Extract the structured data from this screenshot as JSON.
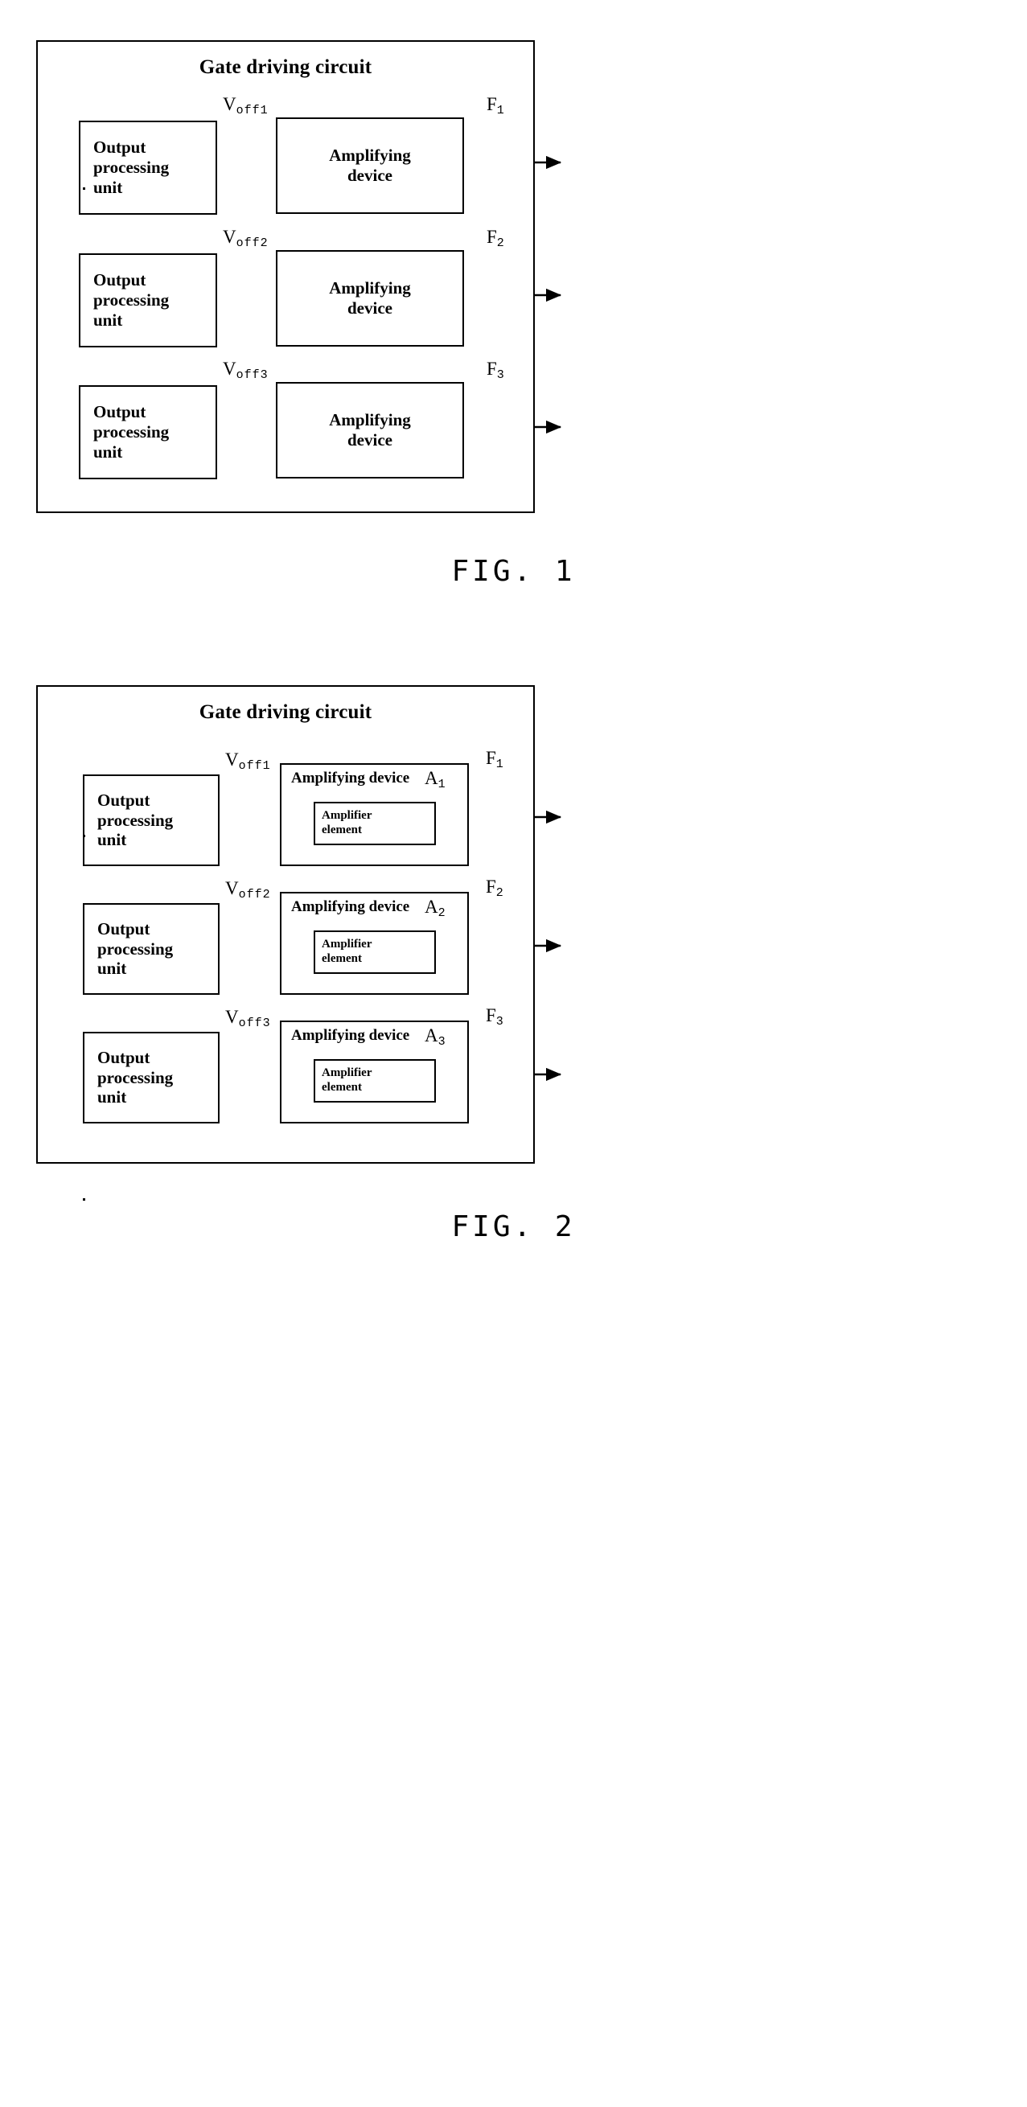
{
  "figures": [
    {
      "id": "fig1",
      "caption": "FIG.  1",
      "circuit_title": "Gate driving circuit",
      "rows": [
        {
          "source_label": "Output processing unit",
          "source_lines": [
            "Output",
            "processing",
            "unit"
          ],
          "voff_base": "V",
          "voff_sub": "off1",
          "amp_label": "Amplifying device",
          "amp_lines": [
            "Amplifying",
            "device"
          ],
          "out_base": "F",
          "out_sub": "1"
        },
        {
          "source_label": "Output processing unit",
          "source_lines": [
            "Output",
            "processing",
            "unit"
          ],
          "voff_base": "V",
          "voff_sub": "off2",
          "amp_label": "Amplifying device",
          "amp_lines": [
            "Amplifying",
            "device"
          ],
          "out_base": "F",
          "out_sub": "2"
        },
        {
          "source_label": "Output processing unit",
          "source_lines": [
            "Output",
            "processing",
            "unit"
          ],
          "voff_base": "V",
          "voff_sub": "off3",
          "amp_label": "Amplifying device",
          "amp_lines": [
            "Amplifying",
            "device"
          ],
          "out_base": "F",
          "out_sub": "3"
        }
      ]
    },
    {
      "id": "fig2",
      "caption": "FIG.  2",
      "circuit_title": "Gate driving circuit",
      "rows": [
        {
          "source_label": "Output processing unit",
          "source_lines": [
            "Output",
            "processing",
            "unit"
          ],
          "voff_base": "V",
          "voff_sub": "off1",
          "amp_label": "Amplifying device",
          "amp_ref_base": "A",
          "amp_ref_sub": "1",
          "element_label": "Amplifier element",
          "element_lines": [
            "Amplifier",
            "element"
          ],
          "out_base": "F",
          "out_sub": "1"
        },
        {
          "source_label": "Output processing unit",
          "source_lines": [
            "Output",
            "processing",
            "unit"
          ],
          "voff_base": "V",
          "voff_sub": "off2",
          "amp_label": "Amplifying device",
          "amp_ref_base": "A",
          "amp_ref_sub": "2",
          "element_label": "Amplifier element",
          "element_lines": [
            "Amplifier",
            "element"
          ],
          "out_base": "F",
          "out_sub": "2"
        },
        {
          "source_label": "Output processing unit",
          "source_lines": [
            "Output",
            "processing",
            "unit"
          ],
          "voff_base": "V",
          "voff_sub": "off3",
          "amp_label": "Amplifying device",
          "amp_ref_base": "A",
          "amp_ref_sub": "3",
          "element_label": "Amplifier element",
          "element_lines": [
            "Amplifier",
            "element"
          ],
          "out_base": "F",
          "out_sub": "3"
        }
      ]
    }
  ],
  "colors": {
    "ink": "#000000",
    "paper": "#ffffff"
  }
}
